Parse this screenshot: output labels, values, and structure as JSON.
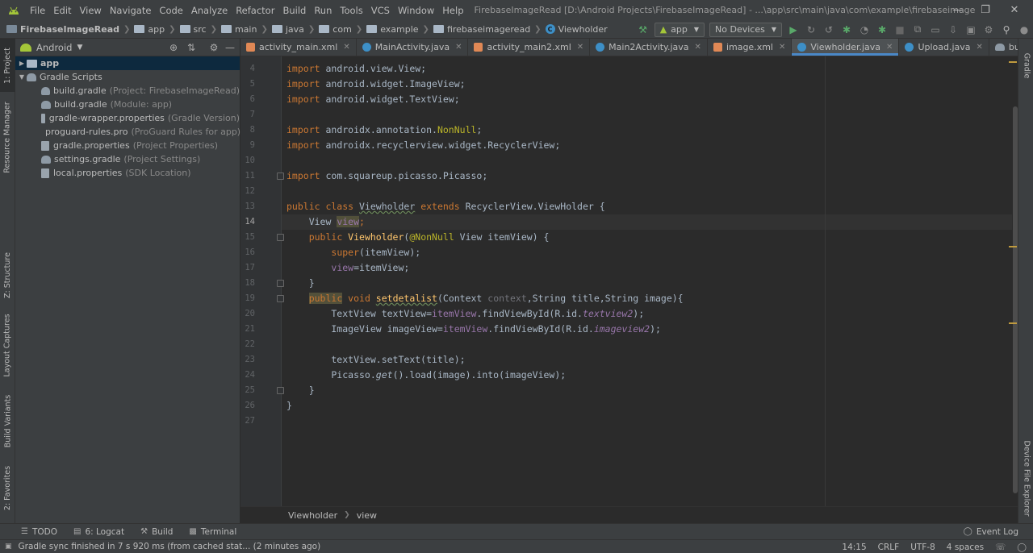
{
  "menubar": {
    "items": [
      "File",
      "Edit",
      "View",
      "Navigate",
      "Code",
      "Analyze",
      "Refactor",
      "Build",
      "Run",
      "Tools",
      "VCS",
      "Window",
      "Help"
    ],
    "title": "FirebaseImageRead [D:\\Android Projects\\FirebaseImageRead] - ...\\app\\src\\main\\java\\com\\example\\firebaseimageread\\Viewholder.java [app]"
  },
  "navbar": {
    "crumbs": [
      "FirebaseImageRead",
      "app",
      "src",
      "main",
      "java",
      "com",
      "example",
      "firebaseimageread",
      "Viewholder"
    ],
    "run_config": "app",
    "device": "No Devices"
  },
  "left_tools": [
    "1: Project",
    "Resource Manager",
    "Z: Structure",
    "Layout Captures",
    "Build Variants",
    "2: Favorites"
  ],
  "right_tools": [
    "Gradle",
    "Device File Explorer"
  ],
  "project": {
    "view": "Android",
    "tree": [
      {
        "name": "app",
        "hint": "",
        "level": 0,
        "kind": "folder",
        "arrow": "▶"
      },
      {
        "name": "Gradle Scripts",
        "hint": "",
        "level": 0,
        "kind": "gradle",
        "arrow": "▼"
      },
      {
        "name": "build.gradle",
        "hint": "(Project: FirebaseImageRead)",
        "level": 1,
        "kind": "gradle",
        "arrow": ""
      },
      {
        "name": "build.gradle",
        "hint": "(Module: app)",
        "level": 1,
        "kind": "gradle",
        "arrow": ""
      },
      {
        "name": "gradle-wrapper.properties",
        "hint": "(Gradle Version)",
        "level": 1,
        "kind": "props",
        "arrow": ""
      },
      {
        "name": "proguard-rules.pro",
        "hint": "(ProGuard Rules for app)",
        "level": 1,
        "kind": "props",
        "arrow": ""
      },
      {
        "name": "gradle.properties",
        "hint": "(Project Properties)",
        "level": 1,
        "kind": "props",
        "arrow": ""
      },
      {
        "name": "settings.gradle",
        "hint": "(Project Settings)",
        "level": 1,
        "kind": "gradle",
        "arrow": ""
      },
      {
        "name": "local.properties",
        "hint": "(SDK Location)",
        "level": 1,
        "kind": "props",
        "arrow": ""
      }
    ]
  },
  "tabs": [
    {
      "label": "activity_main.xml",
      "kind": "xml",
      "active": false
    },
    {
      "label": "MainActivity.java",
      "kind": "java",
      "active": false
    },
    {
      "label": "activity_main2.xml",
      "kind": "xml",
      "active": false
    },
    {
      "label": "Main2Activity.java",
      "kind": "java",
      "active": false
    },
    {
      "label": "image.xml",
      "kind": "xml",
      "active": false
    },
    {
      "label": "Viewholder.java",
      "kind": "java",
      "active": true
    },
    {
      "label": "Upload.java",
      "kind": "java",
      "active": false
    },
    {
      "label": "build.gradle (:app)",
      "kind": "gradle",
      "active": false
    }
  ],
  "editor": {
    "current_line": 14,
    "lines": [
      {
        "n": 4,
        "tokens": [
          [
            "kw",
            "import "
          ],
          [
            "",
            "android.view.View;"
          ]
        ]
      },
      {
        "n": 5,
        "tokens": [
          [
            "kw",
            "import "
          ],
          [
            "",
            "android.widget.ImageView;"
          ]
        ]
      },
      {
        "n": 6,
        "tokens": [
          [
            "kw",
            "import "
          ],
          [
            "",
            "android.widget.TextView;"
          ]
        ]
      },
      {
        "n": 7,
        "tokens": []
      },
      {
        "n": 8,
        "tokens": [
          [
            "kw",
            "import "
          ],
          [
            "",
            "androidx.annotation."
          ],
          [
            "ann",
            "NonNull"
          ],
          [
            "",
            ";"
          ]
        ]
      },
      {
        "n": 9,
        "tokens": [
          [
            "kw",
            "import "
          ],
          [
            "",
            "androidx.recyclerview.widget.RecyclerView;"
          ]
        ]
      },
      {
        "n": 10,
        "tokens": []
      },
      {
        "n": 11,
        "tokens": [
          [
            "kw",
            "import "
          ],
          [
            "",
            "com.squareup.picasso.Picasso;"
          ]
        ]
      },
      {
        "n": 12,
        "tokens": []
      },
      {
        "n": 13,
        "tokens": [
          [
            "kw",
            "public class "
          ],
          [
            "under",
            "Viewholder"
          ],
          [
            "kw",
            " extends "
          ],
          [
            "",
            "RecyclerView.ViewHolder {"
          ]
        ]
      },
      {
        "n": 14,
        "tokens": [
          [
            "",
            "    View "
          ],
          [
            "hlf",
            "view"
          ],
          [
            "kw",
            ";"
          ]
        ]
      },
      {
        "n": 15,
        "tokens": [
          [
            "",
            "    "
          ],
          [
            "kw",
            "public "
          ],
          [
            "method",
            "Viewholder"
          ],
          [
            "",
            "("
          ],
          [
            "ann",
            "@NonNull"
          ],
          [
            "",
            " View itemView) {"
          ]
        ]
      },
      {
        "n": 16,
        "tokens": [
          [
            "",
            "        "
          ],
          [
            "kw",
            "super"
          ],
          [
            "",
            "(itemView);"
          ]
        ]
      },
      {
        "n": 17,
        "tokens": [
          [
            "",
            "        "
          ],
          [
            "field",
            "view"
          ],
          [
            "",
            "=itemView;"
          ]
        ]
      },
      {
        "n": 18,
        "tokens": [
          [
            "",
            "    }"
          ]
        ]
      },
      {
        "n": 19,
        "tokens": [
          [
            "",
            "    "
          ],
          [
            "kwhl",
            "public"
          ],
          [
            "kw",
            " void "
          ],
          [
            "methodu",
            "setdetalist"
          ],
          [
            "",
            "(Context "
          ],
          [
            "param",
            "context"
          ],
          [
            "",
            ",String title,String image){"
          ]
        ]
      },
      {
        "n": 20,
        "tokens": [
          [
            "",
            "        TextView textView="
          ],
          [
            "field",
            "itemView"
          ],
          [
            "",
            ".findViewById(R.id."
          ],
          [
            "fieldi",
            "textview2"
          ],
          [
            "",
            ");"
          ]
        ]
      },
      {
        "n": 21,
        "tokens": [
          [
            "",
            "        ImageView imageView="
          ],
          [
            "field",
            "itemView"
          ],
          [
            "",
            ".findViewById(R.id."
          ],
          [
            "fieldi",
            "imageview2"
          ],
          [
            "",
            ");"
          ]
        ]
      },
      {
        "n": 22,
        "tokens": []
      },
      {
        "n": 23,
        "tokens": [
          [
            "",
            "        textView.setText(title);"
          ]
        ]
      },
      {
        "n": 24,
        "tokens": [
          [
            "",
            "        Picasso."
          ],
          [
            "italic",
            "get"
          ],
          [
            "",
            "().load(image).into(imageView);"
          ]
        ]
      },
      {
        "n": 25,
        "tokens": [
          [
            "",
            "    }"
          ]
        ]
      },
      {
        "n": 26,
        "tokens": [
          [
            "",
            "}"
          ]
        ]
      },
      {
        "n": 27,
        "tokens": []
      }
    ]
  },
  "crumbbar": {
    "items": [
      "Viewholder",
      "view"
    ]
  },
  "bottom_tools": [
    {
      "label": "TODO",
      "icon": "list-icon"
    },
    {
      "label": "6: Logcat",
      "icon": "logcat-icon"
    },
    {
      "label": "Build",
      "icon": "hammer-icon"
    },
    {
      "label": "Terminal",
      "icon": "terminal-icon"
    }
  ],
  "event_log": "Event Log",
  "status": {
    "message": "Gradle sync finished in 7 s 920 ms (from cached stat... (2 minutes ago)",
    "position": "14:15",
    "line_sep": "CRLF",
    "encoding": "UTF-8",
    "indent": "4 spaces"
  },
  "colors": {
    "accent": "#4a88c7",
    "keyword": "#cc7832",
    "annotation": "#bbb529",
    "field": "#9876aa",
    "method": "#ffc66d"
  }
}
